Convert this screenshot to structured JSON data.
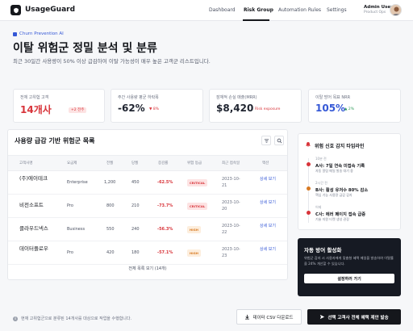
{
  "app": {
    "brand": "UsageGuard"
  },
  "nav": {
    "items": [
      {
        "label": "Dashboard",
        "active": false
      },
      {
        "label": "Risk Group",
        "active": true
      },
      {
        "label": "Automation Rules",
        "active": false
      },
      {
        "label": "Settings",
        "active": false
      }
    ]
  },
  "user": {
    "name": "Admin User",
    "role": "Product Ops"
  },
  "hero": {
    "tag": "Churn Prevention AI",
    "title": "이탈 위험군 정밀 분석 및 분류",
    "subtitle": "최근 30일간 사용량이 50% 이상 급감하여 이탈 가능성이 매우 높은 고객군 리스트입니다."
  },
  "kpis": [
    {
      "label": "전체 고위험 고객",
      "value": "14개사",
      "sub": "+2 전주",
      "value_color": "#d8343a"
    },
    {
      "label": "주간 사용량 평균 하락폭",
      "value": "-62%",
      "sub": "▼ 8%",
      "value_color": "#15171c"
    },
    {
      "label": "잠재적 손실 매출(MRR)",
      "value": "$8,420",
      "sub": "Risk exposure",
      "value_color": "#15171c"
    },
    {
      "label": "이탈 방어 목표 NRR",
      "value": "105%",
      "sub": "▲ 2%",
      "value_color": "#3558d6"
    }
  ],
  "table": {
    "title": "사용량 급감 기반 위험군 목록",
    "columns": [
      "고객사명",
      "요금제",
      "전월",
      "당월",
      "증감률",
      "위험 등급",
      "최근 접속일",
      "액션"
    ],
    "rows": [
      {
        "name": "(주)에이테크",
        "plan": "Enterprise",
        "prev": "1,200",
        "curr": "450",
        "change": "-62.5%",
        "level": "CRITICAL",
        "date": "2023-10-21",
        "action": "상세 보기"
      },
      {
        "name": "비전소프트",
        "plan": "Pro",
        "prev": "800",
        "curr": "210",
        "change": "-73.7%",
        "level": "CRITICAL",
        "date": "2023-10-20",
        "action": "상세 보기"
      },
      {
        "name": "클라우드넥스",
        "plan": "Business",
        "prev": "550",
        "curr": "240",
        "change": "-56.3%",
        "level": "HIGH",
        "date": "2023-10-22",
        "action": "상세 보기"
      },
      {
        "name": "데이터플로우",
        "plan": "Pro",
        "prev": "420",
        "curr": "180",
        "change": "-57.1%",
        "level": "HIGH",
        "date": "2023-10-23",
        "action": "상세 보기"
      }
    ],
    "footer": "전체 목록 보기 (14개)"
  },
  "timeline": {
    "title": "위험 신호 감지 타임라인",
    "events": [
      {
        "time": "10분 전",
        "head": "A사: 7일 연속 미접속 기록",
        "desc": "자동 알림 메일 발송 대기 중"
      },
      {
        "time": "2시간 전",
        "head": "B사: 활성 유저수 80% 감소",
        "desc": "핵심 기능 사용량 급감 감지"
      },
      {
        "time": "어제",
        "head": "C사: 에러 페이지 접속 급증",
        "desc": "기술 지원 티켓 생성 권장"
      }
    ]
  },
  "promo": {
    "title": "자동 방어 활성화",
    "desc": "위험군 감지 시 사용자에게 맞춤형 혜택 메일을 발송하여 이탈률을 24% 개선할 수 있습니다.",
    "button": "설정하러 가기"
  },
  "footer": {
    "note": "현재 고위험군으로 분류된 14개사를 대상으로 작업을 수행합니다.",
    "export": "데이터 CSV 다운로드",
    "send": "선택 고객사 전체 혜택 제안 발송"
  },
  "colors": {
    "accent": "#3558d6",
    "danger": "#d8343a",
    "warning": "#d87a24",
    "dark": "#15171c"
  }
}
